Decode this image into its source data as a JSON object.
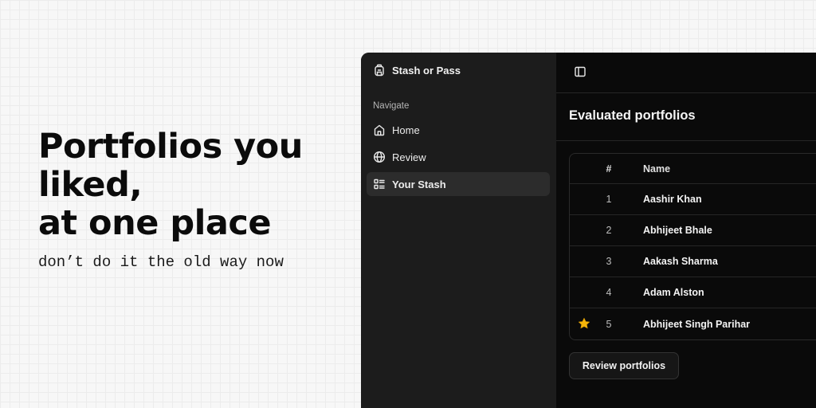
{
  "hero": {
    "title_lines": [
      "Portfolios you",
      "liked,",
      "at one place"
    ],
    "subtitle": "don’t do it the old way now"
  },
  "app": {
    "brand": {
      "name": "Stash or Pass",
      "icon": "backpack-icon"
    },
    "sidebar": {
      "heading": "Navigate",
      "items": [
        {
          "label": "Home",
          "icon": "home-icon",
          "active": false
        },
        {
          "label": "Review",
          "icon": "globe-icon",
          "active": false
        },
        {
          "label": "Your Stash",
          "icon": "list-icon",
          "active": true
        }
      ]
    },
    "main": {
      "title": "Evaluated portfolios",
      "table": {
        "columns": [
          "#",
          "Name"
        ],
        "rows": [
          {
            "num": "1",
            "name": "Aashir Khan",
            "starred": false
          },
          {
            "num": "2",
            "name": "Abhijeet Bhale",
            "starred": false
          },
          {
            "num": "3",
            "name": "Aakash Sharma",
            "starred": false
          },
          {
            "num": "4",
            "name": "Adam Alston",
            "starred": false
          },
          {
            "num": "5",
            "name": "Abhijeet Singh Parihar",
            "starred": true
          }
        ]
      },
      "review_button": "Review portfolios"
    }
  },
  "colors": {
    "app_bg": "#0a0a0a",
    "sidebar_bg": "#1c1c1c",
    "active_item_bg": "#2c2c2c",
    "star": "#f5b50a"
  }
}
